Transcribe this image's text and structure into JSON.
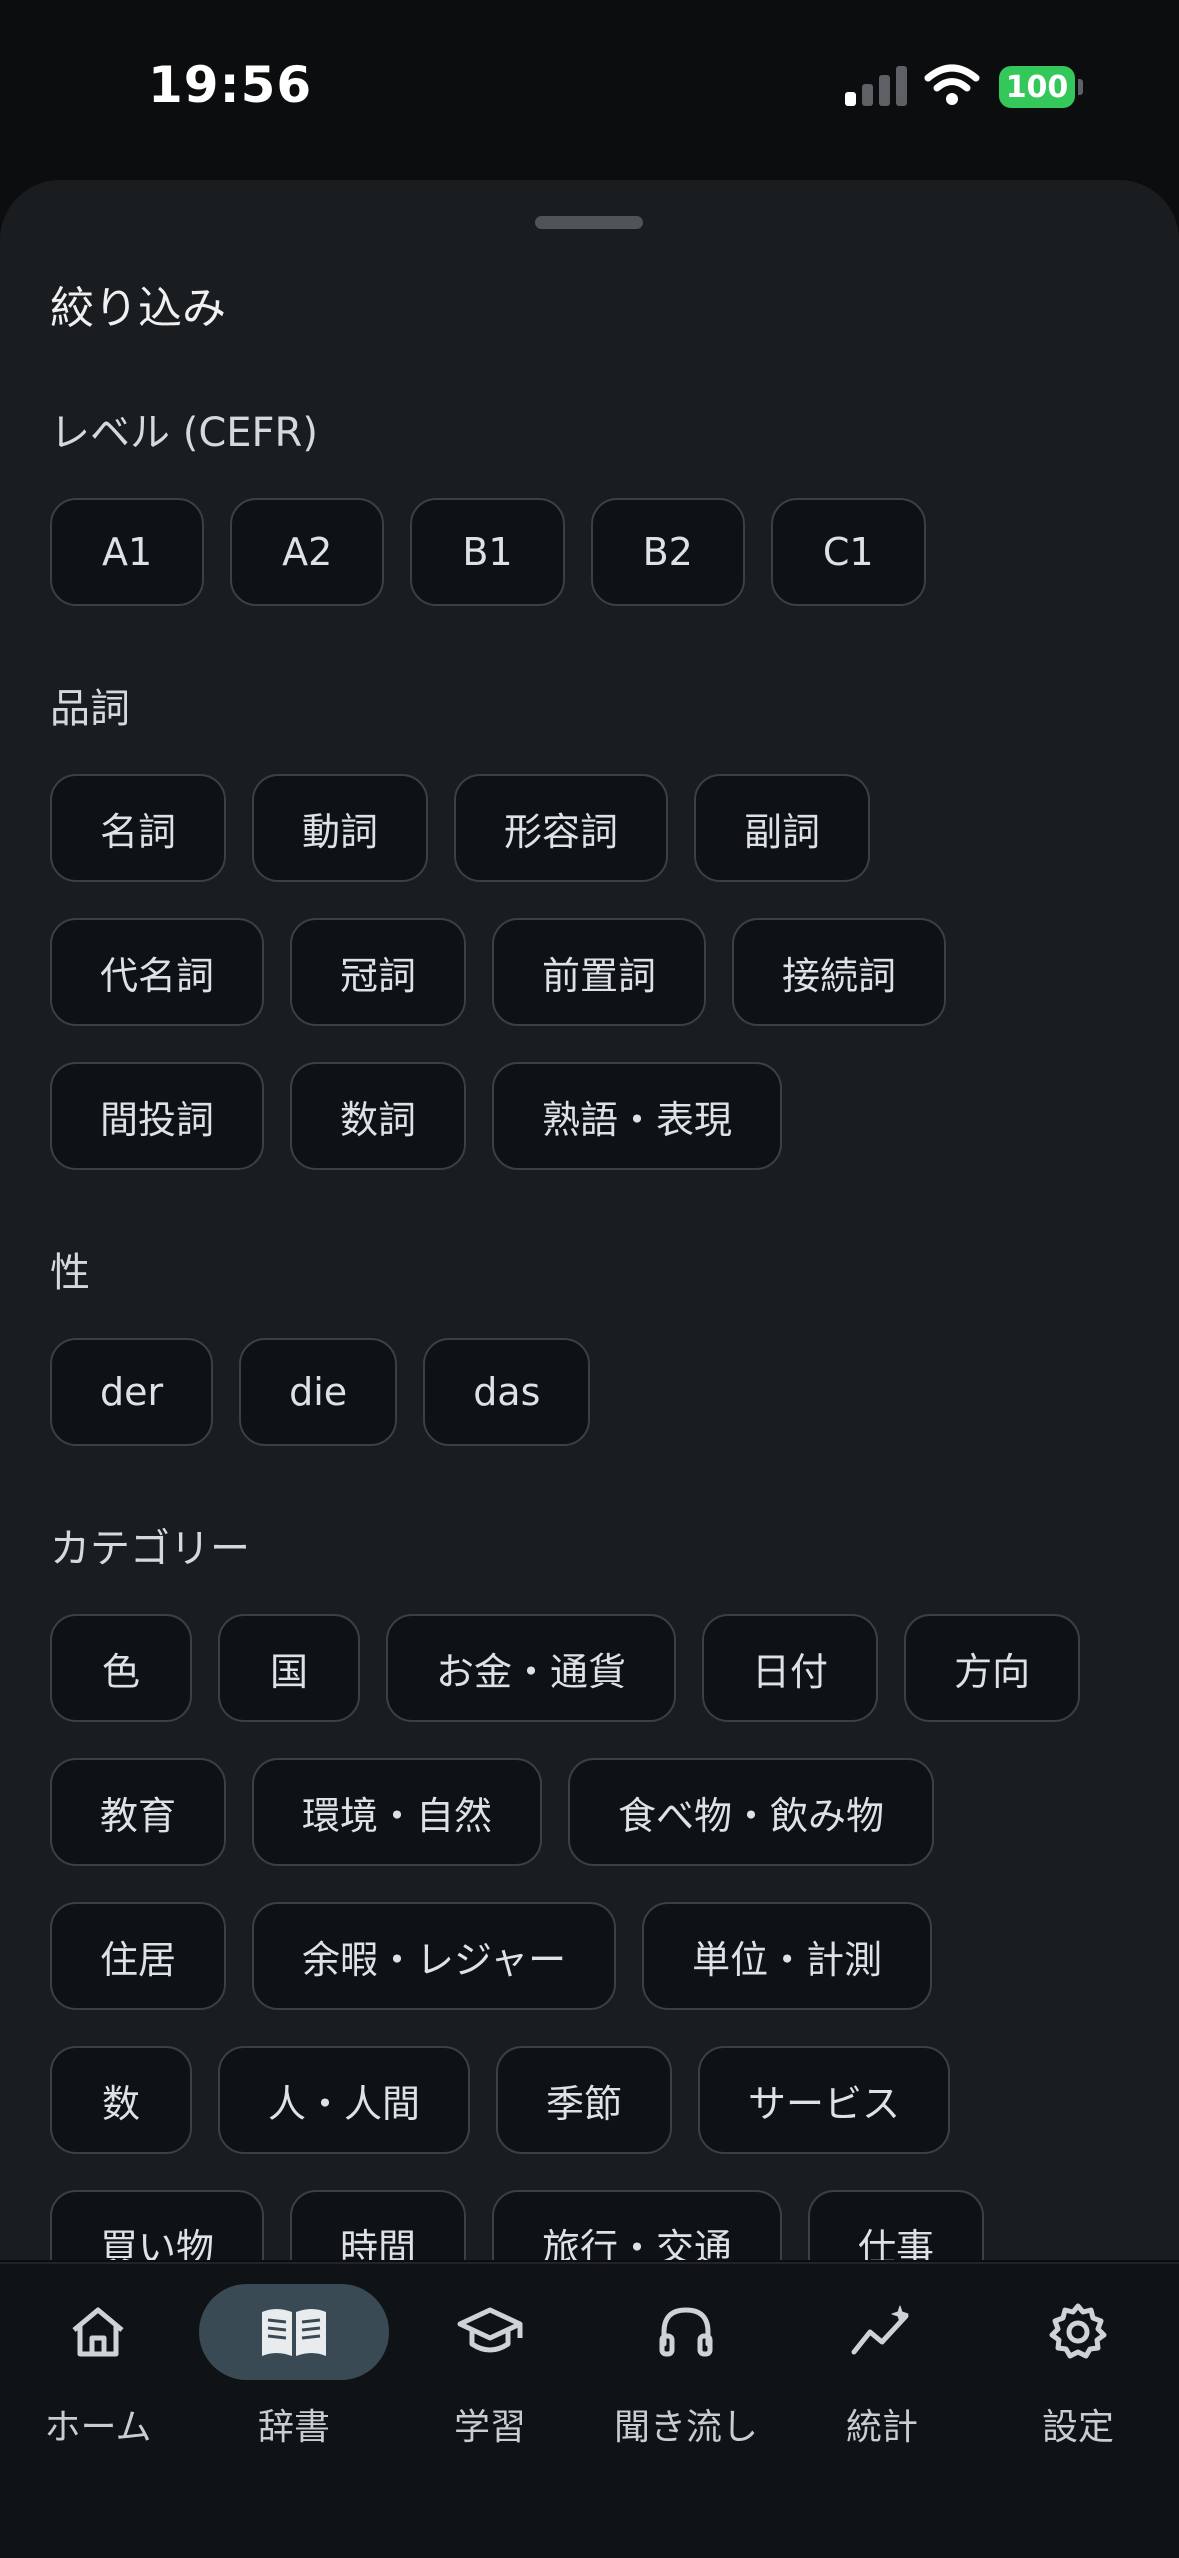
{
  "status": {
    "time": "19:56",
    "battery": "100"
  },
  "sheet": {
    "title": "絞り込み",
    "sections": {
      "level": {
        "label": "レベル (CEFR)",
        "chips": [
          "A1",
          "A2",
          "B1",
          "B2",
          "C1"
        ]
      },
      "pos": {
        "label": "品詞",
        "rows": [
          [
            "名詞",
            "動詞",
            "形容詞",
            "副詞"
          ],
          [
            "代名詞",
            "冠詞",
            "前置詞",
            "接続詞"
          ],
          [
            "間投詞",
            "数詞",
            "熟語・表現"
          ]
        ]
      },
      "gender": {
        "label": "性",
        "chips": [
          "der",
          "die",
          "das"
        ]
      },
      "category": {
        "label": "カテゴリー",
        "rows": [
          [
            "色",
            "国",
            "お金・通貨",
            "日付",
            "方向"
          ],
          [
            "教育",
            "環境・自然",
            "食べ物・飲み物"
          ],
          [
            "住居",
            "余暇・レジャー",
            "単位・計測"
          ],
          [
            "数",
            "人・人間",
            "季節",
            "サービス"
          ],
          [
            "買い物",
            "時間",
            "旅行・交通",
            "仕事"
          ]
        ]
      }
    }
  },
  "tabbar": {
    "items": [
      {
        "label": "ホーム",
        "icon": "home-icon",
        "active": false
      },
      {
        "label": "辞書",
        "icon": "book-icon",
        "active": true
      },
      {
        "label": "学習",
        "icon": "graduation-cap-icon",
        "active": false
      },
      {
        "label": "聞き流し",
        "icon": "headphones-icon",
        "active": false
      },
      {
        "label": "統計",
        "icon": "stats-icon",
        "active": false
      },
      {
        "label": "設定",
        "icon": "gear-icon",
        "active": false
      }
    ]
  }
}
